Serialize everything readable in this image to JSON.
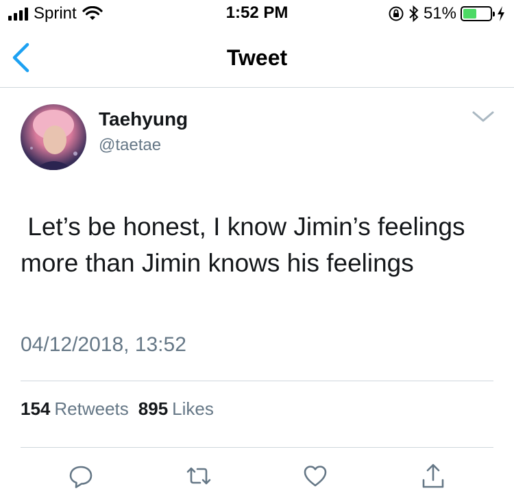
{
  "status_bar": {
    "carrier": "Sprint",
    "time": "1:52 PM",
    "battery_percent_text": "51%",
    "battery_level": 0.51,
    "battery_color": "#4cd964"
  },
  "nav": {
    "title": "Tweet",
    "back_icon": "chevron-left-icon",
    "accent": "#1da1f2"
  },
  "tweet": {
    "display_name": "Taehyung",
    "handle": "@taetae",
    "text": " Let’s be honest, I know Jimin’s feelings more than Jimin knows his feelings",
    "timestamp": "04/12/2018, 13:52",
    "retweets_count": "154",
    "retweets_label": "Retweets",
    "likes_count": "895",
    "likes_label": "Likes"
  },
  "actions": {
    "icons": [
      "reply-icon",
      "retweet-icon",
      "like-icon",
      "share-icon"
    ],
    "icon_color": "#657786"
  }
}
